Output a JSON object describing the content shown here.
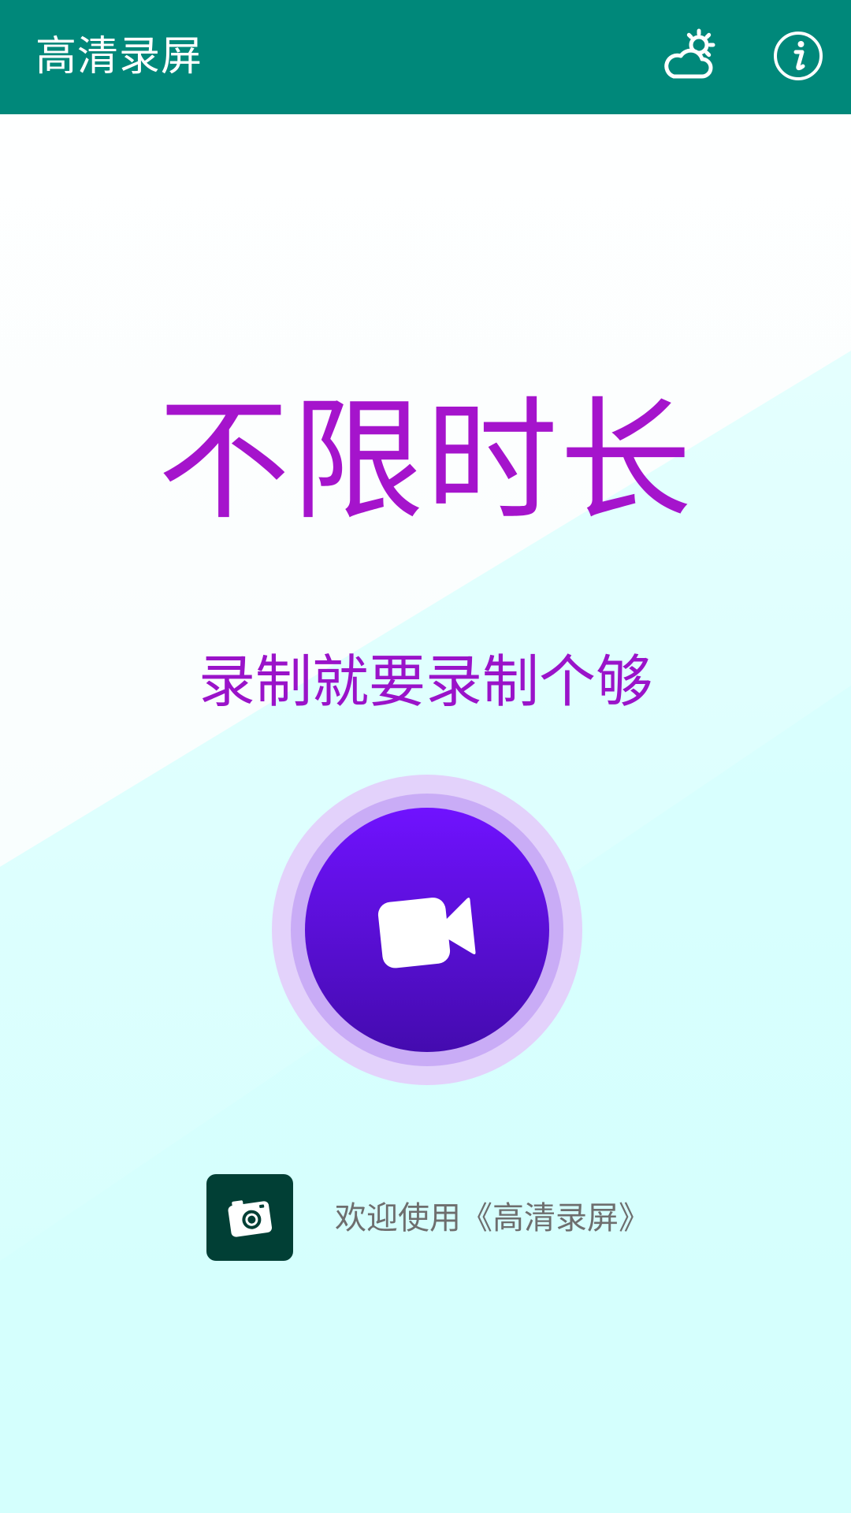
{
  "app_bar": {
    "title": "高清录屏",
    "background_color": "#00887A",
    "weather_icon": "cloud-sun-icon",
    "info_icon": "info-icon"
  },
  "hero": {
    "headline": "不限时长",
    "subline": "录制就要录制个够",
    "text_color": "#A514CC"
  },
  "record_button": {
    "icon": "video-camera-icon",
    "color_top": "#7012FF",
    "color_bottom": "#440BAF"
  },
  "footer": {
    "app_icon": "camera-app-icon",
    "welcome_text": "欢迎使用《高清录屏》"
  },
  "background": {
    "top_color": "#FFFFFF",
    "bottom_color": "#D7FFFD"
  }
}
